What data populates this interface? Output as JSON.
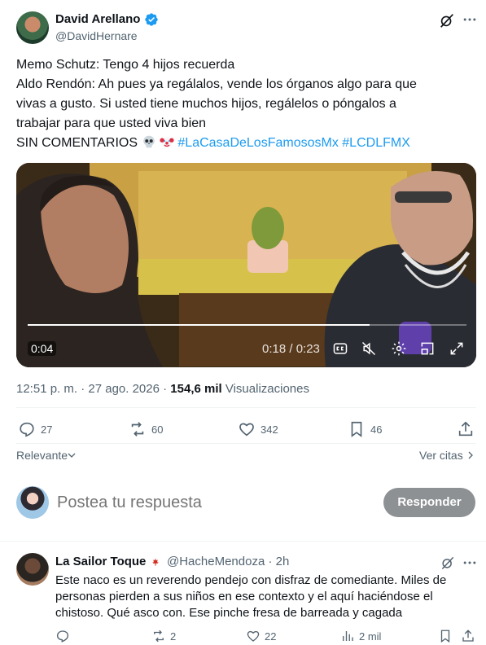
{
  "post": {
    "author_name": "David Arellano",
    "handle": "@DavidHernare",
    "text_lines": [
      "Memo Schutz: Tengo 4 hijos recuerda",
      "Aldo Rendón: Ah pues ya regálalos, vende los órganos algo para que",
      "vivas a gusto. Si usted tiene muchos hijos, regálelos o póngalos a",
      "trabajar para que usted viva bien"
    ],
    "last_line_text": "SIN COMENTARIOS",
    "emojis": [
      "skull-emoji",
      "clown-emoji"
    ],
    "hashtags": [
      "#LaCasaDeLosFamososMx",
      "#LCDLFMX"
    ],
    "video": {
      "remaining_badge": "0:04",
      "time_counter": "0:18 / 0:23",
      "progress_fraction": 0.78,
      "controls": [
        "closed-captions-icon",
        "mute-icon",
        "settings-icon",
        "pip-icon",
        "fullscreen-icon"
      ]
    },
    "timestamp": "12:51 p. m. · 27 ago. 2026 ·",
    "views_count": "154,6 mil",
    "views_label": "Visualizaciones",
    "actions": {
      "replies": "27",
      "reposts": "60",
      "likes": "342",
      "bookmarks": "46"
    }
  },
  "sort": {
    "label": "Relevante",
    "quotes_link": "Ver citas"
  },
  "reply_box": {
    "placeholder": "Postea tu respuesta",
    "button_label": "Responder"
  },
  "comment": {
    "author_name": "La Sailor Toque",
    "flag": "canada-flag-emoji",
    "handle_time": "@HacheMendoza · 2h",
    "text_lines": [
      "Este naco es un reverendo pendejo con disfraz de comediante. Miles de",
      "personas pierden a sus niños en ese contexto y el aquí haciéndose el",
      "chistoso. Qué asco con. Ese pinche fresa de barreada y cagada"
    ],
    "actions": {
      "replies": "",
      "reposts": "2",
      "likes": "22",
      "views": "2 mil"
    }
  },
  "colors": {
    "accent": "#1d9bf0",
    "text_primary": "#0f1419",
    "text_secondary": "#536471",
    "button_disabled": "#8d9194"
  }
}
